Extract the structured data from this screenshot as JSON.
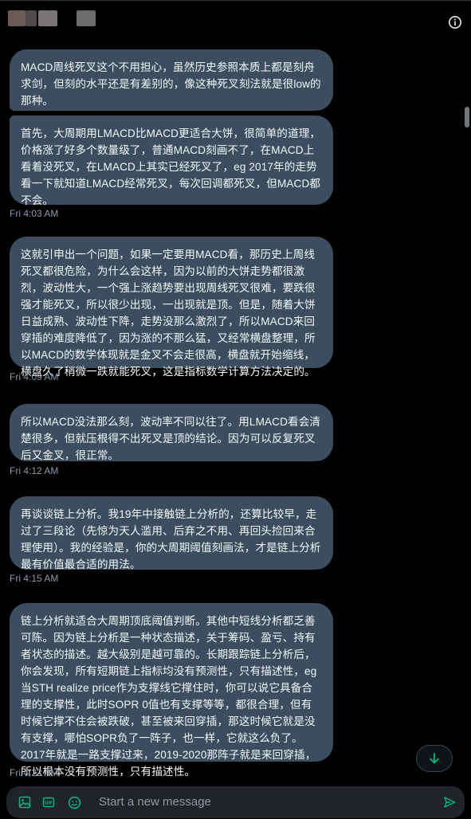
{
  "header": {
    "info_icon": "info-circle-icon"
  },
  "messages": [
    {
      "text": "MACD周线死叉这个不用担心，虽然历史参照本质上都是刻舟求剑，但刻的水平还是有差别的，像这种死叉刻法就是很low的那种。"
    },
    {
      "text": "首先，大周期用LMACD比MACD更适合大饼，很简单的道理，价格涨了好多个数量级了，普通MACD刻画不了，在MACD上看着没死叉，在LMACD上其实已经死叉了，eg 2017年的走势看一下就知道LMACD经常死叉，每次回调都死叉，但MACD都不会。"
    },
    {
      "text": "这就引申出一个问题，如果一定要用MACD看，那历史上周线死叉都很危险，为什么会这样，因为以前的大饼走势都很激烈，波动性大，一个强上涨趋势要出现周线死叉很难，要跌很强才能死叉，所以很少出现，一出现就是顶。但是，随着大饼日益成熟、波动性下降，走势没那么激烈了，所以MACD来回穿插的难度降低了，因为涨的不那么猛，又经常横盘整理，所以MACD的数学体现就是金叉不会走很高，横盘就开始缩线，横盘久了稍微一跌就能死叉，这是指标数学计算方法决定的。"
    },
    {
      "text": "所以MACD没法那么刻，波动率不同以往了。用LMACD看会清楚很多，但就压根得不出死叉是顶的结论。因为可以反复死叉后又金叉，很正常。"
    },
    {
      "text": "再谈谈链上分析。我19年中接触链上分析的，还算比较早，走过了三段论（先惊为天人滥用、后弃之不用、再回头捡回来合理使用）。我的经验是，你的大周期阈值刻画法，才是链上分析最有价值最合适的用法。"
    },
    {
      "text": "链上分析就适合大周期顶底阈值判断。其他中短线分析都乏善可陈。因为链上分析是一种状态描述，关于筹码、盈亏、持有者状态的描述。越大级别是越可靠的。长期跟踪链上分析后，你会发现，所有短期链上指标均没有预测性，只有描述性，eg 当STH realize price作为支撑线它撑住时，你可以说它具备合理的支撑性，此时SOPR 0值也有支撑等等，都很合理，但有时候它撑不住会被跌破，甚至被来回穿插，那这时候它就是没有支撑，哪怕SOPR负了一阵子，也一样，它就这么负了。2017年就是一路支撑过来，2019-2020那阵子就是来回穿插，所以根本没有预测性，只有描述性。"
    }
  ],
  "timestamps": [
    "Fri 4:03 AM",
    "Fri 4:09 AM",
    "Fri 4:12 AM",
    "Fri 4:15 AM",
    "Fri 4:22 AM"
  ],
  "composer": {
    "placeholder": "Start a new message",
    "icons": [
      "image-icon",
      "gif-icon",
      "emoji-icon",
      "send-icon"
    ]
  },
  "colors": {
    "bubble": "#3b4d5f",
    "accent": "#00ba7c",
    "timestamp": "#8b98a5"
  }
}
